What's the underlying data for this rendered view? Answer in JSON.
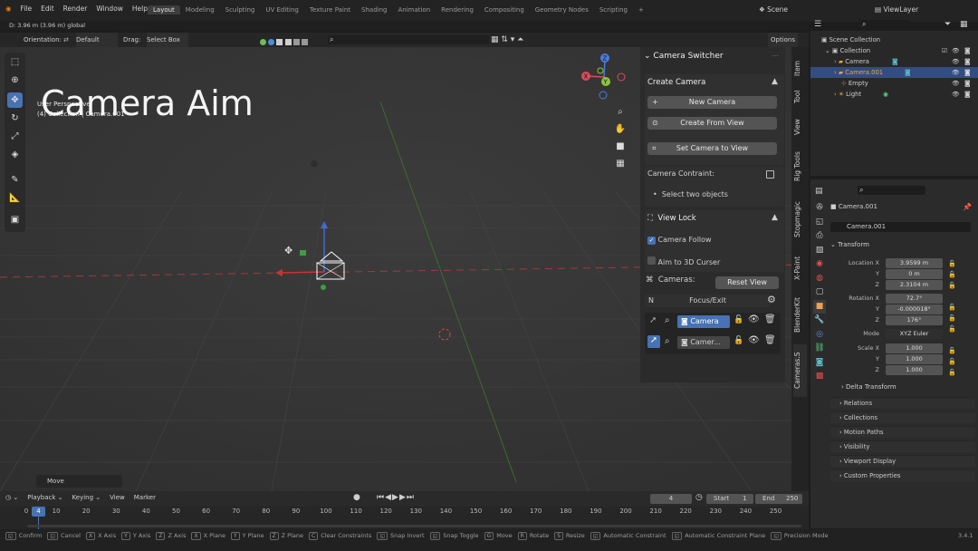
{
  "menu": [
    "File",
    "Edit",
    "Render",
    "Window",
    "Help"
  ],
  "workspaces": [
    "Layout",
    "Modeling",
    "Sculpting",
    "UV Editing",
    "Texture Paint",
    "Shading",
    "Animation",
    "Rendering",
    "Compositing",
    "Geometry Nodes",
    "Scripting"
  ],
  "scene_label": "Scene",
  "viewlayer_label": "ViewLayer",
  "header_info": "D: 3.96 m (3.96 m) global",
  "tool_header": {
    "orientation_label": "Orientation:",
    "orientation_value": "Default",
    "drag_label": "Drag:",
    "drag_value": "Select Box",
    "options": "Options"
  },
  "viewport": {
    "perspective": "User Perspective",
    "collection_info": "(4) Collection | Camera.001",
    "overlay_title": "Camera Aim",
    "last_op": "Move"
  },
  "npanel": {
    "title": "Camera Switcher",
    "create_camera_header": "Create Camera",
    "new_camera": "New Camera",
    "create_from_view": "Create From View",
    "set_camera_to_view": "Set Camera to View",
    "camera_constraint": "Camera Contraint:",
    "select_two": "Select two objects",
    "view_lock_header": "View Lock",
    "camera_follow": "Camera Follow",
    "aim_to_cursor": "Aim to 3D Curser",
    "cameras_label": "Cameras:",
    "reset_view": "Reset View",
    "focus_key": "N",
    "focus_exit": "Focus/Exit",
    "cam_list": [
      {
        "name": "Camera"
      },
      {
        "name": "Camer..."
      }
    ]
  },
  "side_tabs": [
    "Item",
    "Tool",
    "View",
    "Rig Tools",
    "Stopmagic",
    "X-Paint",
    "BlenderKit",
    "Cameras.S"
  ],
  "outliner": {
    "scene_collection": "Scene Collection",
    "collection": "Collection",
    "items": [
      "Camera",
      "Camera.001",
      "Empty",
      "Light"
    ]
  },
  "properties": {
    "object_name": "Camera.001",
    "object_field": "Camera.001",
    "transform": "Transform",
    "location_label": "Location X",
    "loc": [
      "3.9599 m",
      "0 m",
      "2.3104 m"
    ],
    "rotation_label": "Rotation X",
    "rot": [
      "72.7°",
      "-0.000018°",
      "176°"
    ],
    "mode_label": "Mode",
    "mode_value": "XYZ Euler",
    "scale_label": "Scale X",
    "scale": [
      "1.000",
      "1.000",
      "1.000"
    ],
    "axis_y": "Y",
    "axis_z": "Z",
    "delta_transform": "Delta Transform",
    "sections": [
      "Relations",
      "Collections",
      "Motion Paths",
      "Visibility",
      "Viewport Display",
      "Custom Properties"
    ]
  },
  "timeline": {
    "playback": "Playback",
    "keying": "Keying",
    "view": "View",
    "marker": "Marker",
    "current_frame": "4",
    "start_label": "Start",
    "start": "1",
    "end_label": "End",
    "end": "250",
    "ticks": [
      "0",
      "10",
      "20",
      "30",
      "40",
      "50",
      "60",
      "70",
      "80",
      "90",
      "100",
      "110",
      "120",
      "130",
      "140",
      "150",
      "160",
      "170",
      "180",
      "190",
      "200",
      "210",
      "220",
      "230",
      "240",
      "250"
    ],
    "frame_marker": "4"
  },
  "statusbar": {
    "items": [
      {
        "key": "",
        "label": "Confirm"
      },
      {
        "key": "",
        "label": "Cancel"
      },
      {
        "key": "X",
        "label": "X Axis"
      },
      {
        "key": "Y",
        "label": "Y Axis"
      },
      {
        "key": "Z",
        "label": "Z Axis"
      },
      {
        "key": "X",
        "label": "X Plane"
      },
      {
        "key": "Y",
        "label": "Y Plane"
      },
      {
        "key": "Z",
        "label": "Z Plane"
      },
      {
        "key": "C",
        "label": "Clear Constraints"
      },
      {
        "key": "",
        "label": "Snap Invert"
      },
      {
        "key": "",
        "label": "Snap Toggle"
      },
      {
        "key": "G",
        "label": "Move"
      },
      {
        "key": "R",
        "label": "Rotate"
      },
      {
        "key": "S",
        "label": "Resize"
      },
      {
        "key": "",
        "label": "Automatic Constraint"
      },
      {
        "key": "",
        "label": "Automatic Constraint Plane"
      },
      {
        "key": "",
        "label": "Precision Mode"
      }
    ],
    "version": "3.4.1"
  }
}
